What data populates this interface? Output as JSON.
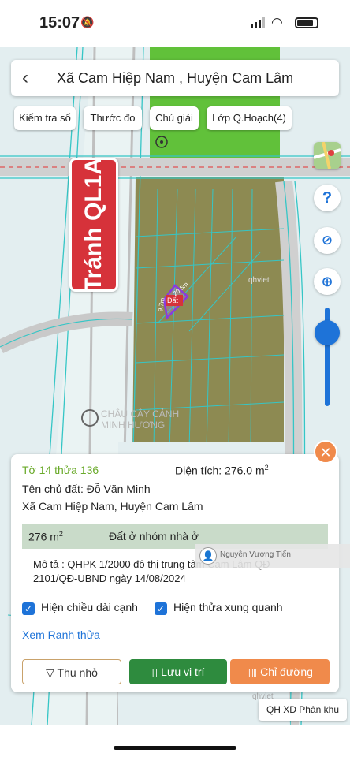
{
  "status": {
    "time": "15:07"
  },
  "header": {
    "title": "Xã Cam Hiệp Nam , Huyện Cam Lâm"
  },
  "toolbar": {
    "check_book": "Kiểm tra sổ",
    "ruler": "Thước đo",
    "legend": "Chú giải",
    "plan_layers": "Lớp Q.Hoạch(4)"
  },
  "map": {
    "road_label": "Tránh QL1A",
    "watermark_1": "qhviet",
    "watermark_2": "qhviet",
    "watermark_3": "qhviet",
    "place_label_1": "CHÂU CÂY CẢNH",
    "place_label_2": "MINH HƯƠNG",
    "parcel_label": "Đất",
    "edge_1": "20.5m",
    "edge_2": "9.7m"
  },
  "parcel": {
    "sheet_parcel": "Tờ 14 thửa 136",
    "area_label": "Diện tích: 276.0 m",
    "area_sup": "2",
    "owner": "Tên chủ đất: Đỗ Văn Minh",
    "address": "Xã Cam Hiệp Nam, Huyện Cam Lâm",
    "area_row_value": "276 m",
    "area_row_sup": "2",
    "land_type": "Đất ở nhóm nhà ở",
    "description_line1": "Mô tả : QHPK 1/2000 đô thị trung tâm Cam Lâm QĐ",
    "description_line2": "2101/QĐ-UBND ngày 14/08/2024",
    "show_edges": "Hiện chiều dài cạnh",
    "show_neighbors": "Hiện thửa xung quanh",
    "view_boundary": "Xem Ranh thửa",
    "shrink": "Thu nhỏ",
    "save_location": "Lưu vị trí",
    "directions": "Chỉ đường"
  },
  "overlay": {
    "user_name": "Nguyễn Vương Tiến"
  },
  "badge": {
    "plan_type": "QH XD Phân khu"
  },
  "colors": {
    "accent_blue": "#1e73d8",
    "save_green": "#2e8b3e",
    "directions_orange": "#f08a4b",
    "road_sign_red": "#d6323a",
    "zone_green": "#61c13a",
    "land_olive": "#8d8a52"
  }
}
